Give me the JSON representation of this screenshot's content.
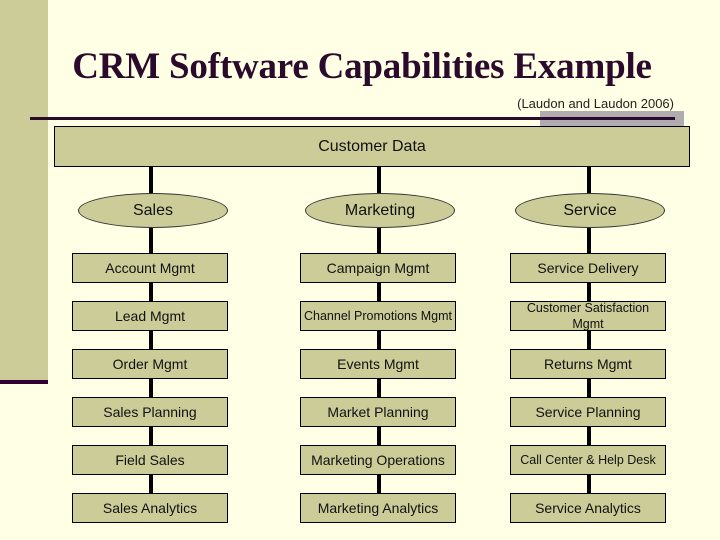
{
  "slide": {
    "title": "CRM Software Capabilities Example",
    "citation": "(Laudon and Laudon 2006)"
  },
  "diagram": {
    "root": {
      "label": "Customer Data"
    },
    "columns": [
      {
        "label": "Sales",
        "capabilities": [
          "Account Mgmt",
          "Lead Mgmt",
          "Order Mgmt",
          "Sales Planning",
          "Field Sales",
          "Sales Analytics"
        ]
      },
      {
        "label": "Marketing",
        "capabilities": [
          "Campaign Mgmt",
          "Channel Promotions Mgmt",
          "Events Mgmt",
          "Market Planning",
          "Marketing Operations",
          "Marketing Analytics"
        ]
      },
      {
        "label": "Service",
        "capabilities": [
          "Service Delivery",
          "Customer Satisfaction Mgmt",
          "Returns Mgmt",
          "Service Planning",
          "Call Center & Help Desk",
          "Service Analytics"
        ]
      }
    ]
  },
  "colors": {
    "background": "#ffffe6",
    "box_fill": "#cccc99",
    "title_color": "#2b0a2b",
    "accent_gray": "#b0acb0"
  }
}
